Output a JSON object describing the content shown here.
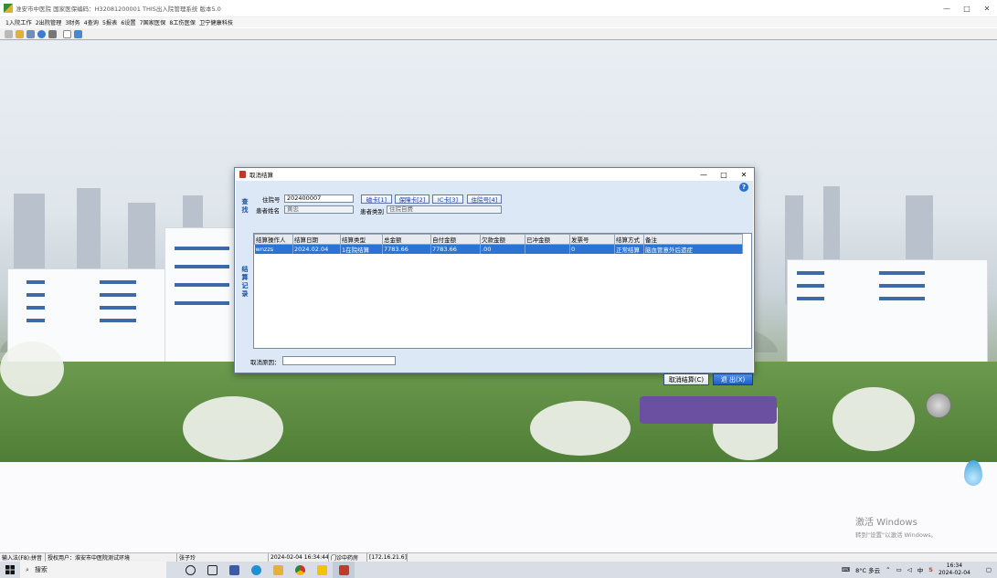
{
  "window": {
    "title": "淮安市中医院 国家医保编码：H32081200001 THIS出入院管理系统 版本5.0",
    "controls": [
      "—",
      "□",
      "✕"
    ]
  },
  "menu": [
    "1入院工作",
    "2出院管理",
    "3财务",
    "4查询",
    "5报表",
    "6设置",
    "7国家医保",
    "8工伤医保",
    "卫宁健康科技"
  ],
  "toolbar_icons": [
    "lock-icon",
    "key-icon",
    "print-icon",
    "refresh-icon",
    "user-icon",
    "mail-icon",
    "exit-icon"
  ],
  "dialog": {
    "title": "取消结算",
    "controls": [
      "—",
      "□",
      "✕"
    ],
    "find_label": "查找",
    "records_label": "结算记录",
    "admission_no_label": "住院号",
    "admission_no": "202400007",
    "patient_name_label": "患者姓名",
    "patient_name": "黄忠",
    "patient_type_label": "患者类别",
    "patient_type": "住院自费",
    "card_buttons": [
      "磁卡[1]",
      "保障卡[2]",
      "IC卡[3]",
      "住院号[4]"
    ],
    "table": {
      "columns": [
        "结算操作人",
        "结算日期",
        "结算类型",
        "总金额",
        "自付金额",
        "欠款金额",
        "已冲金额",
        "发票号",
        "结算方式",
        "备注"
      ],
      "rows": [
        [
          "wnzzs",
          "2024.02.04",
          "1在院结算",
          "7783.66",
          "7783.66",
          ".00",
          "",
          "0",
          "正常结算",
          "脑血管意外后遗症"
        ]
      ]
    },
    "cancel_reason_label": "取消原因：",
    "cancel_reason": "",
    "cancel_button": "取消结算(C)",
    "exit_button": "退 出(X)"
  },
  "watermark": {
    "line1": "激活 Windows",
    "line2": "转到\"设置\"以激活 Windows。"
  },
  "statusbar": [
    "输入法(F8):拼音",
    "授权用户：淮安市中医院测试环境",
    "张子玲",
    "2024-02-04 16:34:44",
    "门诊中药房",
    "[172.16.21.6]"
  ],
  "taskbar": {
    "search_placeholder": "搜索",
    "tray_weather": "8°C 多云",
    "tray_lang": "中",
    "time": "16:34",
    "date": "2024-02-04"
  },
  "colors": {
    "selection": "#2a74d6",
    "dialog_bg": "#dce8f6",
    "primary_button": "#1f5fc4"
  }
}
